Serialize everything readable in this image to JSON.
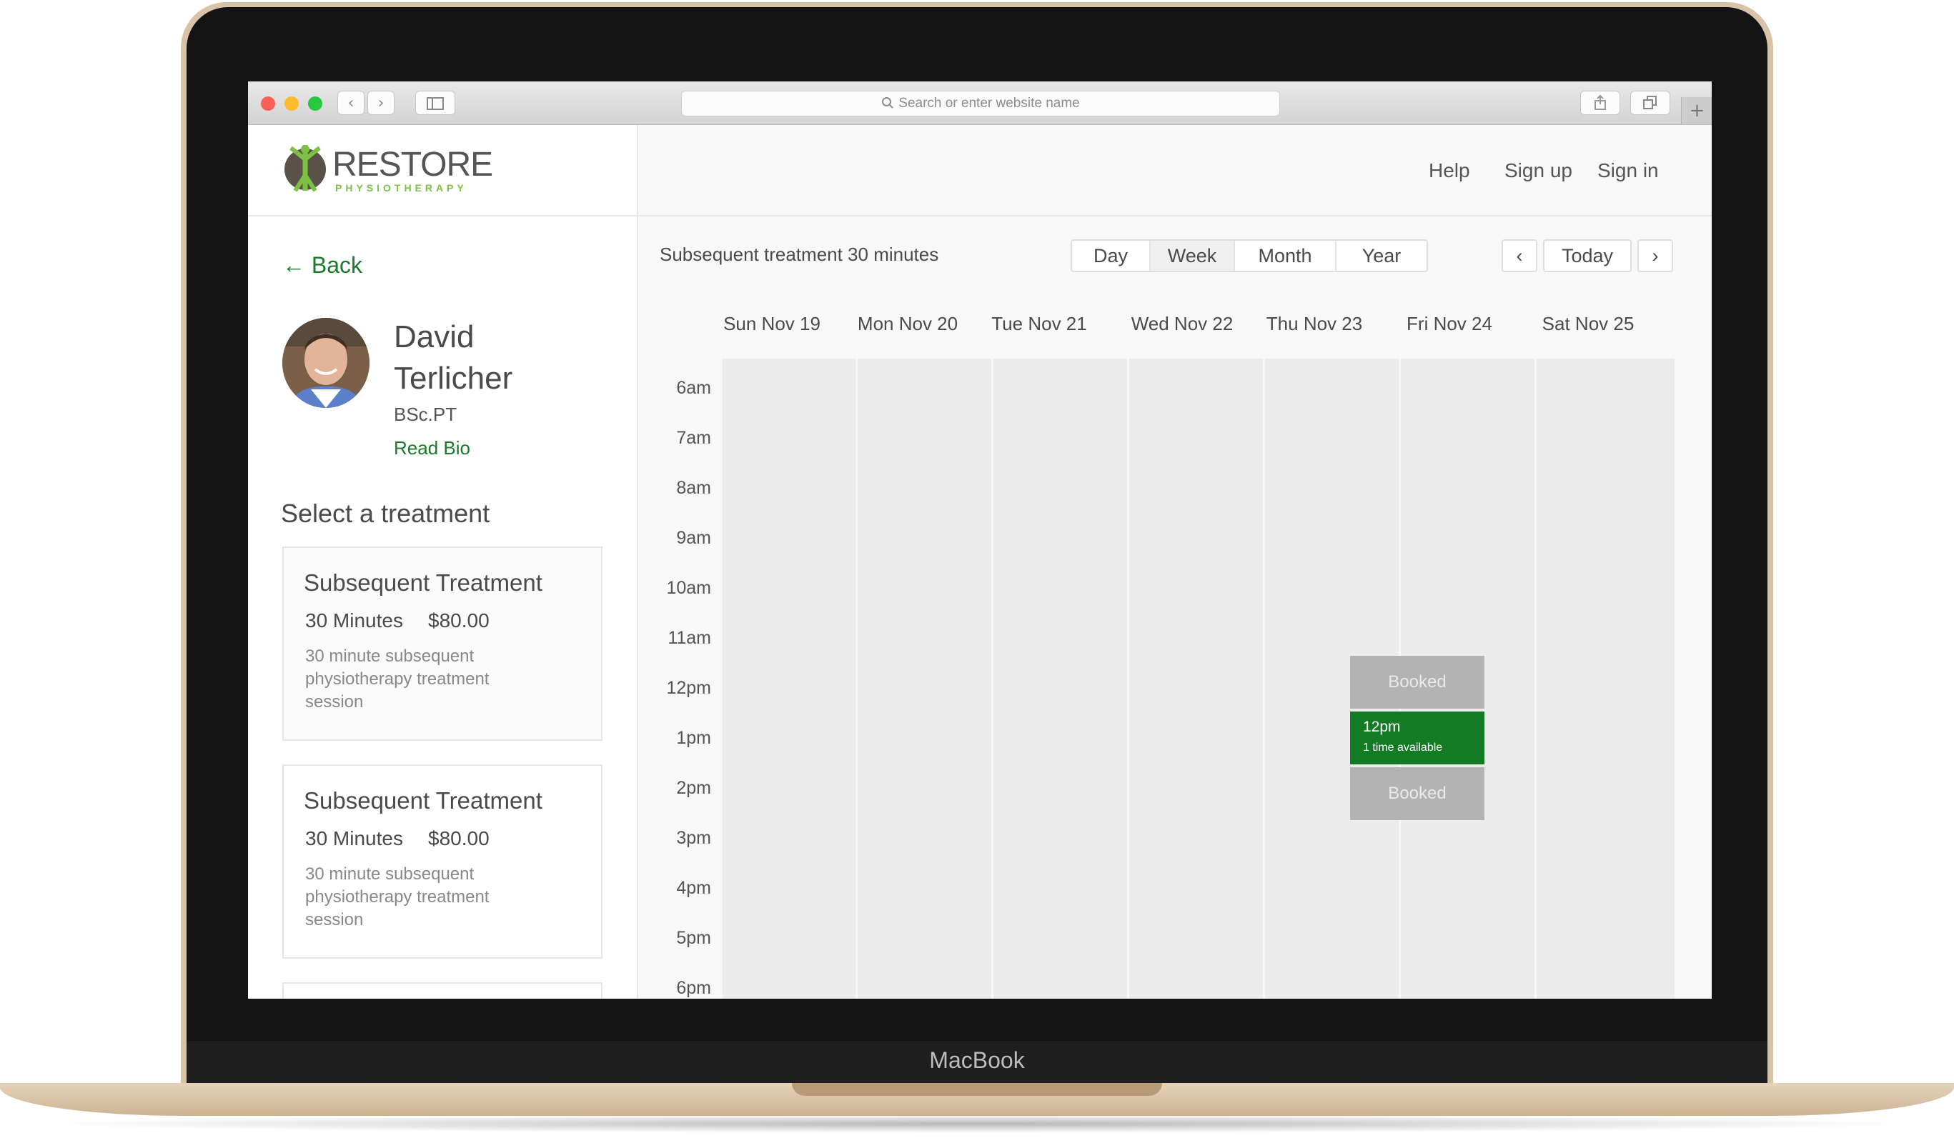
{
  "device_label": "MacBook",
  "browser": {
    "url_placeholder": "Search or enter website name",
    "new_tab": "+"
  },
  "site": {
    "logo_text": "RESTORE",
    "logo_sub": "PHYSIOTHERAPY",
    "nav": {
      "help": "Help",
      "sign_up": "Sign up",
      "sign_in": "Sign in"
    }
  },
  "sidebar": {
    "back": "← Back",
    "doctor": {
      "first": "David",
      "last": "Terlicher",
      "credentials": "BSc.PT",
      "bio_link": "Read Bio"
    },
    "select_heading": "Select a treatment",
    "treatments": [
      {
        "title": "Subsequent Treatment",
        "duration": "30 Minutes",
        "price": "$80.00",
        "description": "30 minute subsequent physiotherapy treatment session"
      },
      {
        "title": "Subsequent Treatment",
        "duration": "30 Minutes",
        "price": "$80.00",
        "description": "30 minute subsequent physiotherapy treatment session"
      }
    ]
  },
  "calendar": {
    "treatment_label": "Subsequent treatment 30 minutes",
    "views": [
      "Day",
      "Week",
      "Month",
      "Year"
    ],
    "active_view": "Week",
    "prev": "‹",
    "today": "Today",
    "next": "›",
    "days": [
      "Sun Nov 19",
      "Mon Nov 20",
      "Tue Nov 21",
      "Wed Nov 22",
      "Thu Nov 23",
      "Fri Nov 24",
      "Sat Nov 25"
    ],
    "hours": [
      "6am",
      "7am",
      "8am",
      "9am",
      "10am",
      "11am",
      "12pm",
      "1pm",
      "2pm",
      "3pm",
      "4pm",
      "5pm",
      "6pm"
    ],
    "events": [
      {
        "label": "Booked",
        "status": "booked"
      },
      {
        "time": "12pm",
        "note": "1 time available",
        "status": "available",
        "color": "#137b24"
      },
      {
        "label": "Booked",
        "status": "booked"
      }
    ]
  }
}
